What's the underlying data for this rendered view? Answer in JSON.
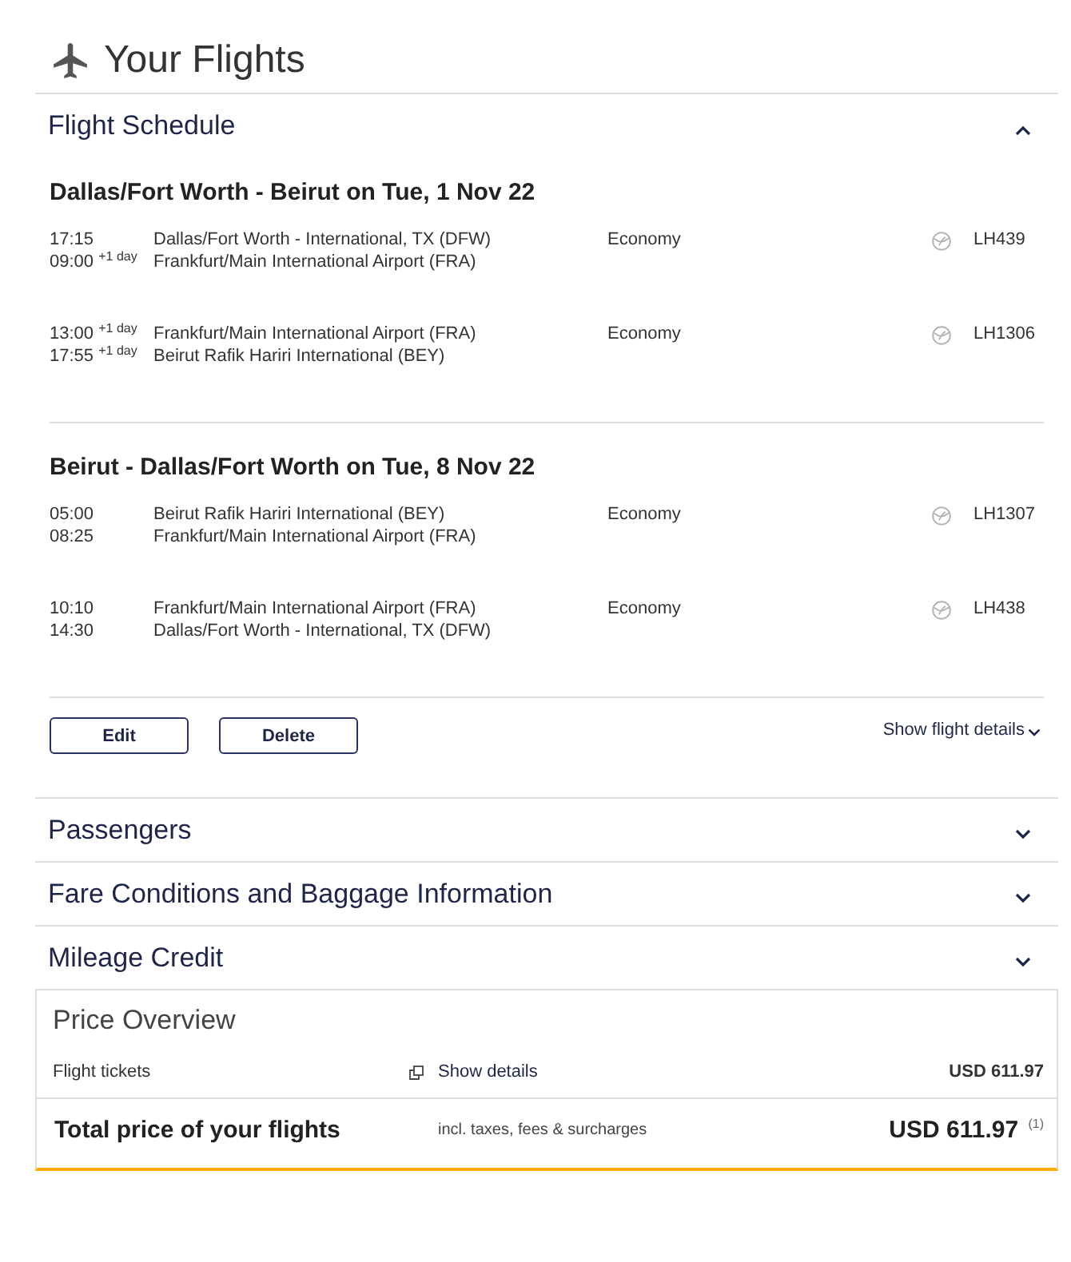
{
  "header": {
    "title": "Your Flights"
  },
  "sections": [
    {
      "title": "Flight Schedule",
      "expanded": true,
      "bounds": [
        {
          "heading": "Dallas/Fort Worth - Beirut on Tue, 1 Nov 22",
          "segments": [
            {
              "departure_time": "17:15",
              "origin": "Dallas/Fort Worth - International, TX (DFW)",
              "cabin": "Economy",
              "flight_number": "LH439",
              "arrival_time": "09:00 $^{+1 day}$",
              "destination": "Frankfurt/Main International Airport (FRA)"
            },
            {
              "departure_time": "13:00 $^{+1 day}$",
              "origin": "Frankfurt/Main International Airport (FRA)",
              "cabin": "Economy",
              "flight_number": "LH1306",
              "arrival_time": "17:55 $^{+1 day}$",
              "destination": "Beirut Rafik Hariri International (BEY)"
            }
          ]
        },
        {
          "heading": "Beirut - Dallas/Fort Worth on Tue, 8 Nov 22",
          "segments": [
            {
              "departure_time": "05:00",
              "origin": "Beirut Rafik Hariri International (BEY)",
              "cabin": "Economy",
              "flight_number": "LH1307",
              "arrival_time": "08:25",
              "destination": "Frankfurt/Main International Airport (FRA)"
            },
            {
              "departure_time": "10:10",
              "origin": "Frankfurt/Main International Airport (FRA)",
              "cabin": "Economy",
              "flight_number": "LH438",
              "arrival_time": "14:30",
              "destination": "Dallas/Fort Worth - International, TX (DFW)"
            }
          ]
        }
      ],
      "actions": {
        "buttons": [
          "Edit",
          "Delete"
        ],
        "details_link": "Show flight details"
      }
    },
    {
      "title": "Passengers",
      "expanded": false
    },
    {
      "title": "Fare Conditions and Baggage Information",
      "expanded": false
    },
    {
      "title": "Mileage Credit",
      "expanded": false
    }
  ],
  "price_overview": {
    "title": "Price Overview",
    "rows": [
      {
        "label": "Flight tickets",
        "link": "Show details",
        "amount": "USD 611.97"
      }
    ],
    "total": {
      "label": "Total price of your flights",
      "note": "incl. taxes, fees & surcharges",
      "amount": "USD 611.97 $^{(1)}$"
    }
  }
}
